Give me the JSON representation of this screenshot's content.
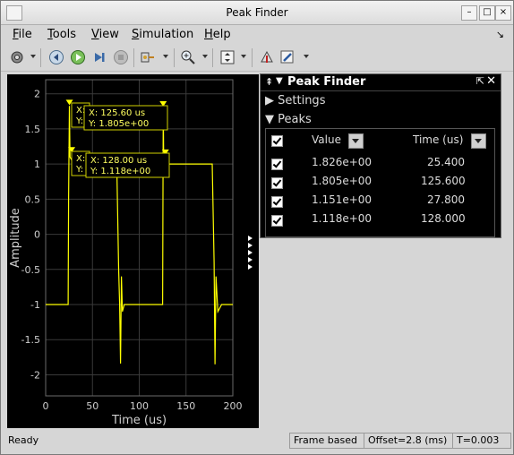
{
  "window": {
    "title": "Peak Finder"
  },
  "menu": [
    "File",
    "Tools",
    "View",
    "Simulation",
    "Help"
  ],
  "menu_mnemonics": [
    "F",
    "T",
    "V",
    "S",
    "H"
  ],
  "toolbar_icons": [
    "gear-icon",
    "step-back-icon",
    "run-icon",
    "step-forward-icon",
    "stop-icon",
    "insert-probe-icon",
    "zoom-in-icon",
    "autoscale-icon",
    "highlight-icon",
    "edit-icon"
  ],
  "plot": {
    "ylabel": "Amplitude",
    "xlabel": "Time (us)",
    "yticks": [
      "2",
      "1.5",
      "1",
      "0.5",
      "0",
      "-0.5",
      "-1",
      "-1.5",
      "-2"
    ],
    "xticks": [
      "0",
      "50",
      "100",
      "150",
      "200"
    ],
    "line_color": "#ffff00",
    "background": "#000000",
    "grid_color": "#3a3a3a",
    "callout1": {
      "xline": "X: 125.60 us",
      "yline": "Y:  1.805e+00"
    },
    "callout2": {
      "xline": "X: 128.00 us",
      "yline": "Y:  1.118e+00"
    },
    "callout_stubs": [
      "X:",
      "Y:"
    ]
  },
  "chart_data": {
    "type": "line",
    "xlabel": "Time (us)",
    "ylabel": "Amplitude",
    "xlim": [
      0,
      200
    ],
    "ylim": [
      -2.3,
      2.2
    ],
    "series": [
      {
        "x": [
          0,
          24,
          24.5,
          25.4,
          26,
          30,
          76,
          78,
          79,
          80,
          81,
          82,
          84,
          88,
          125,
          125.6,
          126,
          128,
          132,
          178,
          180,
          181,
          182,
          184,
          188,
          200
        ],
        "y": [
          -1,
          -1,
          0.5,
          1.826,
          1.1,
          1,
          1,
          -0.5,
          -1,
          -1.84,
          -0.6,
          -1.1,
          -1,
          -1,
          -1,
          1.805,
          1.2,
          1.118,
          1,
          1,
          -0.4,
          -1.85,
          -0.6,
          -1.1,
          -1,
          -1
        ]
      }
    ],
    "peaks": [
      {
        "x": 25.4,
        "y": 1.826
      },
      {
        "x": 125.6,
        "y": 1.805
      },
      {
        "x": 27.8,
        "y": 1.151
      },
      {
        "x": 128.0,
        "y": 1.118
      }
    ]
  },
  "panel": {
    "title": "Peak Finder",
    "settings_label": "Settings",
    "peaks_label": "Peaks",
    "col_value": "Value",
    "col_time": "Time (us)",
    "rows": [
      {
        "value": "1.826e+00",
        "time": "25.400"
      },
      {
        "value": "1.805e+00",
        "time": "125.600"
      },
      {
        "value": "1.151e+00",
        "time": "27.800"
      },
      {
        "value": "1.118e+00",
        "time": "128.000"
      }
    ]
  },
  "status": {
    "ready": "Ready",
    "mode": "Frame based",
    "offset": "Offset=2.8 (ms)",
    "time": "T=0.003"
  }
}
